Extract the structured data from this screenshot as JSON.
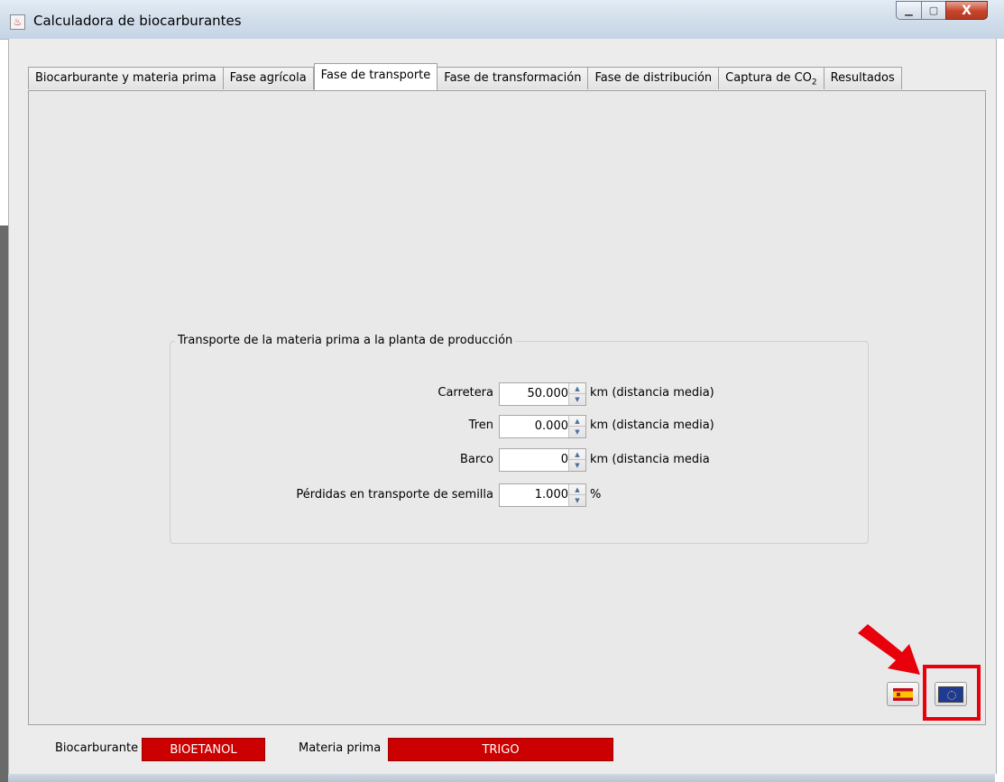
{
  "window": {
    "title": "Calculadora de biocarburantes",
    "controls": {
      "minimize": "▁",
      "maximize": "▢",
      "close": "X"
    }
  },
  "tabs": [
    {
      "label": "Biocarburante y materia prima",
      "active": false
    },
    {
      "label": "Fase agrícola",
      "active": false
    },
    {
      "label": "Fase de transporte",
      "active": true
    },
    {
      "label": "Fase de transformación",
      "active": false
    },
    {
      "label": "Fase de distribución",
      "active": false
    },
    {
      "label_main": "Captura de CO",
      "label_sub": "2",
      "active": false
    },
    {
      "label": "Resultados",
      "active": false
    }
  ],
  "transport_group": {
    "title": "Transporte de la materia prima a la planta de producción",
    "rows": [
      {
        "label": "Carretera",
        "value": "50.000",
        "unit": "km (distancia media)"
      },
      {
        "label": "Tren",
        "value": "0.000",
        "unit": "km (distancia media)"
      },
      {
        "label": "Barco",
        "value": "0",
        "unit": "km (distancia media"
      },
      {
        "label": "Pérdidas en transporte de semilla",
        "value": "1.000",
        "unit": "%"
      }
    ]
  },
  "language_buttons": [
    {
      "name": "spanish",
      "icon": "flag-es-icon"
    },
    {
      "name": "european-union",
      "icon": "flag-eu-icon"
    }
  ],
  "footer": {
    "biocarburante_label": "Biocarburante",
    "biocarburante_value": "BIOETANOL",
    "materia_label": "Materia prima",
    "materia_value": "TRIGO"
  },
  "colors": {
    "footer_value_bg": "#cc0000",
    "highlight": "#e8000b"
  }
}
